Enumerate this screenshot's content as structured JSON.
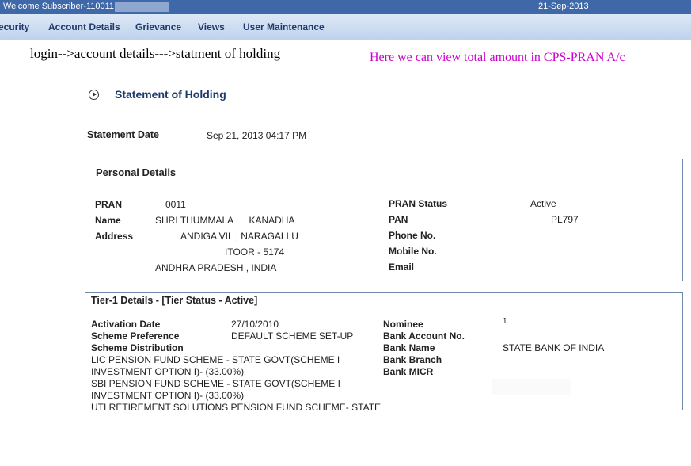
{
  "header": {
    "welcome": "Welcome Subscriber-110011",
    "date": "21-Sep-2013"
  },
  "menu": [
    "ecurity",
    "Account Details",
    "Grievance",
    "Views",
    "User Maintenance"
  ],
  "annotations": {
    "path": "login-->account details--->statment of holding",
    "note": "Here we can view total amount in CPS-PRAN A/c"
  },
  "page": {
    "title": "Statement of Holding",
    "statement_date_label": "Statement Date",
    "statement_date_value": "Sep 21, 2013 04:17 PM"
  },
  "personal": {
    "title": "Personal Details",
    "left": [
      {
        "label": "PRAN",
        "value": "0011"
      },
      {
        "label": "Name",
        "value": "SHRI THUMMALA      KANADHA"
      },
      {
        "label": "Address",
        "value": "ANDIGA VIL , NARAGALLU"
      }
    ],
    "address_line2": "ITOOR - 5174",
    "address_line3": "ANDHRA PRADESH , INDIA",
    "right": [
      {
        "label": "PRAN Status",
        "value": "Active"
      },
      {
        "label": "PAN",
        "value": "PL797"
      },
      {
        "label": "Phone No.",
        "value": ""
      },
      {
        "label": "Mobile No.",
        "value": ""
      },
      {
        "label": "Email",
        "value": ""
      }
    ]
  },
  "tier1": {
    "title": "Tier-1 Details - [Tier Status - Active]",
    "activation_label": "Activation Date",
    "activation_value": "27/10/2010",
    "pref_label": "Scheme Preference",
    "pref_value": "DEFAULT SCHEME SET-UP",
    "dist_label": "Scheme Distribution",
    "dist_lines": [
      "LIC PENSION FUND SCHEME - STATE GOVT(SCHEME I",
      "INVESTMENT OPTION I)-  (33.00%)",
      "SBI PENSION FUND SCHEME - STATE GOVT(SCHEME I",
      "INVESTMENT OPTION I)-  (33.00%)",
      "UTI RETIREMENT SOLUTIONS PENSION FUND SCHEME- STATE"
    ],
    "right": [
      {
        "label": "Nominee",
        "value": "1"
      },
      {
        "label": "Bank Account No.",
        "value": ""
      },
      {
        "label": "Bank Name",
        "value": "STATE BANK OF INDIA"
      },
      {
        "label": "Bank Branch",
        "value": ""
      },
      {
        "label": "Bank MICR",
        "value": ""
      }
    ]
  }
}
